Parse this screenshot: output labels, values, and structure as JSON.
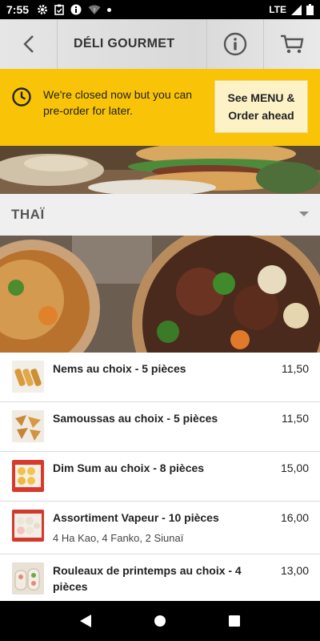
{
  "status_bar": {
    "time": "7:55",
    "network": "LTE",
    "icons_left": [
      "gear-icon",
      "clipboard-check-icon",
      "info-icon",
      "wifi-icon",
      "dot-icon"
    ],
    "icons_right": [
      "signal-icon",
      "battery-icon"
    ]
  },
  "app_bar": {
    "title": "DÉLI GOURMET",
    "back_icon": "chevron-left-icon",
    "info_icon": "info-icon",
    "cart_icon": "cart-icon"
  },
  "banner": {
    "message": "We're closed now but you can pre-order for later.",
    "cta_label_line1": "See MENU &",
    "cta_label_line2": "Order ahead",
    "background": "#f9c407"
  },
  "category": {
    "name": "THAÏ"
  },
  "items": [
    {
      "name": "Nems au choix - 5 pièces",
      "price": "11,50",
      "description": ""
    },
    {
      "name": "Samoussas au choix - 5 pièces",
      "price": "11,50",
      "description": ""
    },
    {
      "name": "Dim Sum au choix - 8 pièces",
      "price": "15,00",
      "description": ""
    },
    {
      "name": "Assortiment Vapeur - 10 pièces",
      "price": "16,00",
      "description": "4 Ha Kao, 4 Fanko, 2 Siunaï"
    },
    {
      "name": "Rouleaux de printemps au choix - 4 pièces",
      "price": "13,00",
      "description": ""
    }
  ]
}
